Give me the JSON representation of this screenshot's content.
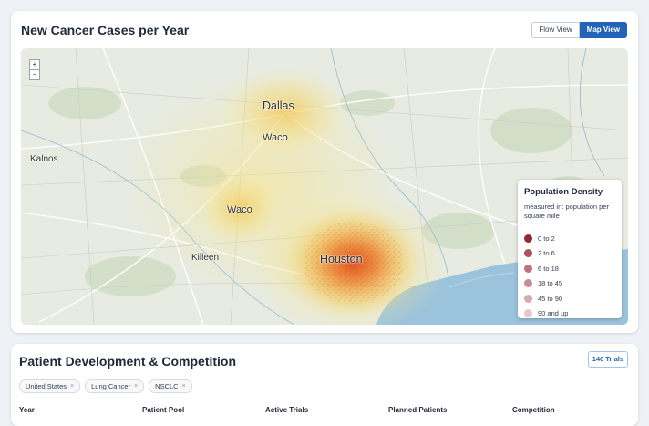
{
  "map_panel": {
    "title": "New Cancer Cases per Year",
    "view_toggle": {
      "flow_label": "Flow View",
      "map_label": "Map View",
      "selected": "Map View"
    },
    "zoom": {
      "in": "+",
      "out": "−"
    },
    "cities": {
      "dallas": "Dallas",
      "waco_north": "Waco",
      "kalnos": "Kalnos",
      "waco_south": "Waco",
      "killeen": "Killeen",
      "houston": "Houston"
    },
    "legend": {
      "title": "Population Density",
      "subtitle": "measured in: population per square mile",
      "items": [
        {
          "label": "0 to 2",
          "color": "#8e2a36"
        },
        {
          "label": "2 to 6",
          "color": "#a9545e"
        },
        {
          "label": "6 to 18",
          "color": "#bb7480"
        },
        {
          "label": "18 to 45",
          "color": "#c88d98"
        },
        {
          "label": "45 to 90",
          "color": "#d6aab2"
        },
        {
          "label": "90 and up",
          "color": "#e6c8cd"
        }
      ]
    }
  },
  "patient_panel": {
    "title": "Patient Development & Competition",
    "trials_button": "140 Trials",
    "filters": [
      {
        "label": "United States",
        "remove": "×"
      },
      {
        "label": "Lung Cancer",
        "remove": "×"
      },
      {
        "label": "NSCLC",
        "remove": "×"
      }
    ],
    "columns": [
      "Year",
      "Patient Pool",
      "Active Trials",
      "Planned Patients",
      "Competition"
    ]
  }
}
